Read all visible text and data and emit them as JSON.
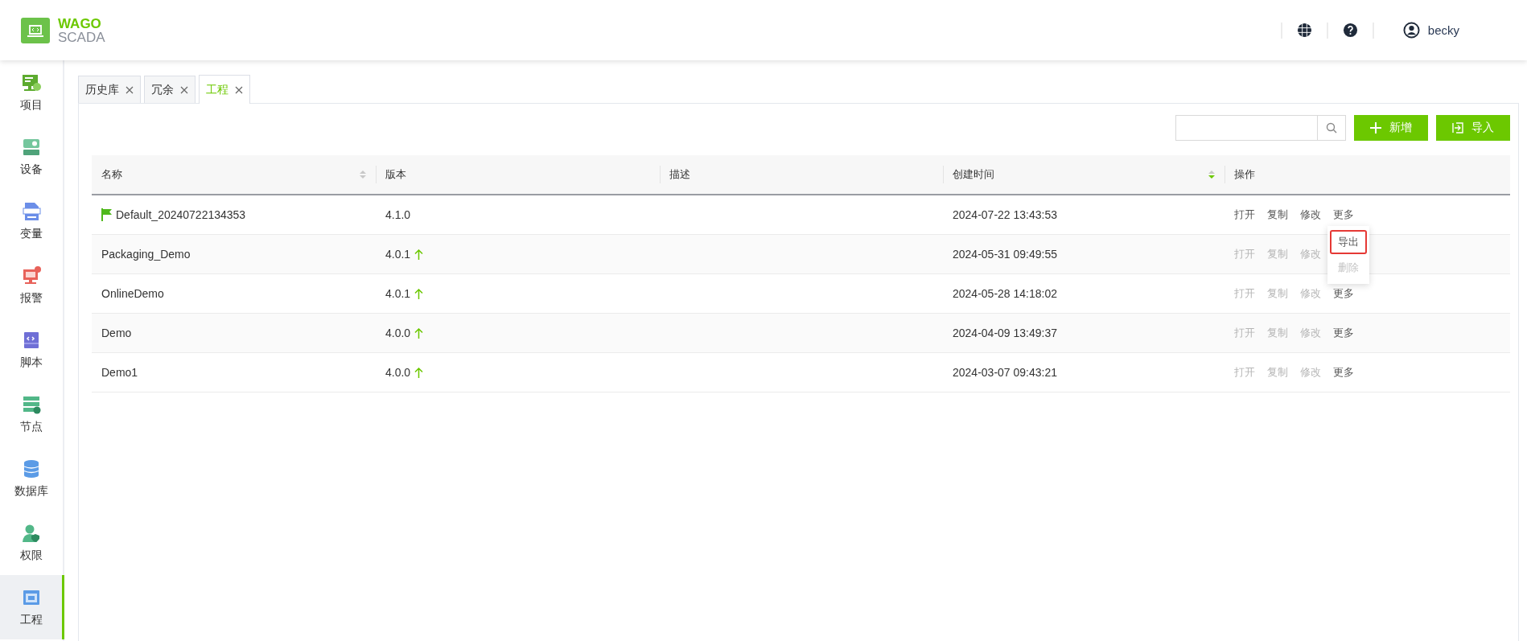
{
  "header": {
    "logo_top": "WAGO",
    "logo_bottom": "SCADA",
    "user": "becky"
  },
  "sidebar": {
    "items": [
      {
        "label": "项目",
        "selected": false
      },
      {
        "label": "设备",
        "selected": false
      },
      {
        "label": "变量",
        "selected": false
      },
      {
        "label": "报警",
        "selected": false
      },
      {
        "label": "脚本",
        "selected": false
      },
      {
        "label": "节点",
        "selected": false
      },
      {
        "label": "数据库",
        "selected": false
      },
      {
        "label": "权限",
        "selected": false
      },
      {
        "label": "工程",
        "selected": true
      }
    ]
  },
  "tabs": [
    {
      "label": "历史库",
      "selected": false
    },
    {
      "label": "冗余",
      "selected": false
    },
    {
      "label": "工程",
      "selected": true
    }
  ],
  "toolbar": {
    "buttons": [
      {
        "label": "新增",
        "kind": "add"
      },
      {
        "label": "导入",
        "kind": "import"
      }
    ]
  },
  "table": {
    "columns": [
      {
        "label": "名称",
        "sortable": true,
        "sorted": false
      },
      {
        "label": "版本"
      },
      {
        "label": "描述"
      },
      {
        "label": "创建时间",
        "sortable": true,
        "sorted": true
      },
      {
        "label": "操作"
      }
    ],
    "rows": [
      {
        "name": "Default_20240722134353",
        "default": true,
        "version": "4.1.0",
        "upgradable": false,
        "created": "2024-07-22 13:43:53",
        "actions": [
          {
            "label": "打开",
            "disabled": false
          },
          {
            "label": "复制",
            "disabled": false
          },
          {
            "label": "修改",
            "disabled": false
          },
          {
            "label": "更多",
            "disabled": false
          }
        ],
        "menu": [
          {
            "label": "导出",
            "highlighted": true,
            "disabled": false
          },
          {
            "label": "删除",
            "highlighted": false,
            "disabled": true
          }
        ]
      },
      {
        "name": "Packaging_Demo",
        "default": false,
        "version": "4.0.1",
        "upgradable": true,
        "created": "2024-05-31 09:49:55",
        "actions": [
          {
            "label": "打开",
            "disabled": true
          },
          {
            "label": "复制",
            "disabled": true
          },
          {
            "label": "修改",
            "disabled": true
          }
        ]
      },
      {
        "name": "OnlineDemo",
        "default": false,
        "version": "4.0.1",
        "upgradable": true,
        "created": "2024-05-28 14:18:02",
        "actions": [
          {
            "label": "打开",
            "disabled": true
          },
          {
            "label": "复制",
            "disabled": true
          },
          {
            "label": "修改",
            "disabled": true
          },
          {
            "label": "更多",
            "disabled": false
          }
        ]
      },
      {
        "name": "Demo",
        "default": false,
        "version": "4.0.0",
        "upgradable": true,
        "created": "2024-04-09 13:49:37",
        "actions": [
          {
            "label": "打开",
            "disabled": true
          },
          {
            "label": "复制",
            "disabled": true
          },
          {
            "label": "修改",
            "disabled": true
          },
          {
            "label": "更多",
            "disabled": false
          }
        ]
      },
      {
        "name": "Demo1",
        "default": false,
        "version": "4.0.0",
        "upgradable": true,
        "created": "2024-03-07 09:43:21",
        "actions": [
          {
            "label": "打开",
            "disabled": true
          },
          {
            "label": "复制",
            "disabled": true
          },
          {
            "label": "修改",
            "disabled": true
          },
          {
            "label": "更多",
            "disabled": false
          }
        ]
      }
    ]
  }
}
